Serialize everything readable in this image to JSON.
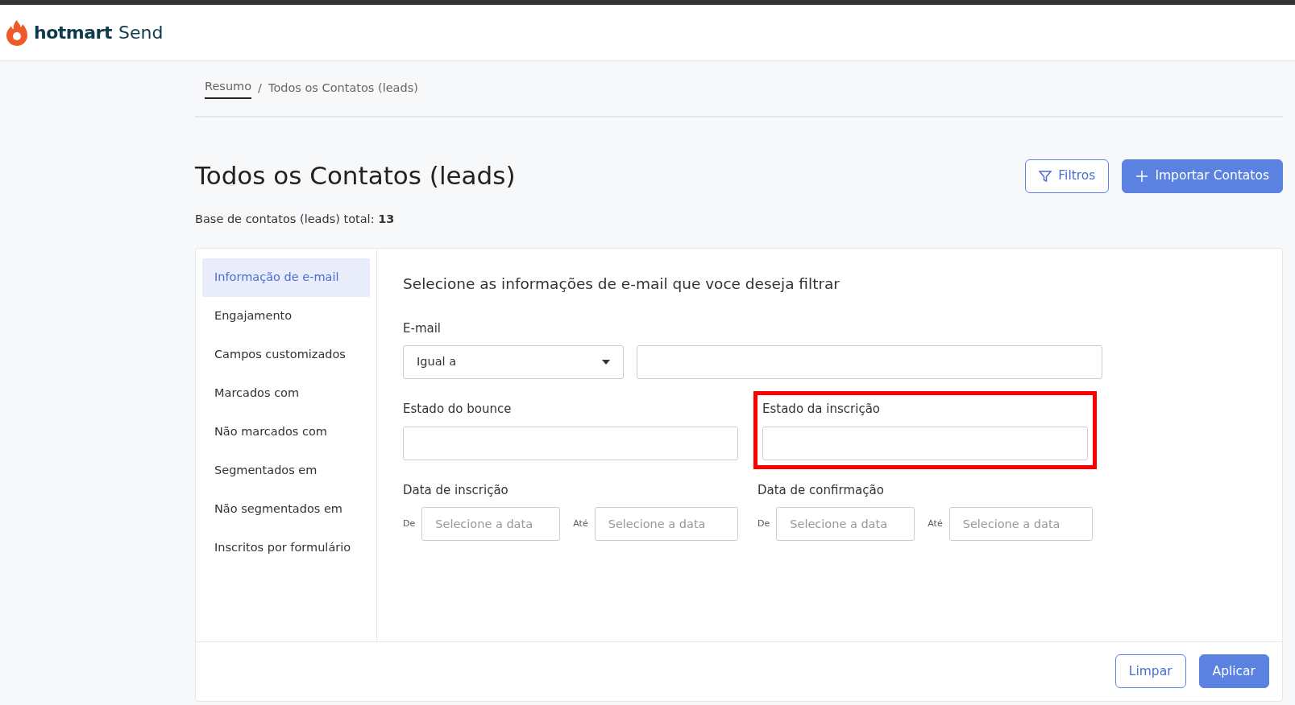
{
  "brand": {
    "name": "hotmart",
    "product": "Send"
  },
  "breadcrumb": [
    {
      "label": "Resumo",
      "link": true
    },
    {
      "separator": "/",
      "label": "Todos os Contatos (leads)",
      "link": false
    }
  ],
  "title": "Todos os Contatos (leads)",
  "buttons": [
    {
      "label": "Filtros",
      "kind": "outline"
    },
    {
      "label": "Importar Contatos",
      "kind": "primary"
    }
  ],
  "total": {
    "label": "Base de contatos (leads) total:",
    "value": "13"
  },
  "filter_menu": [
    {
      "label": "Informação de e-mail",
      "selected": true
    },
    {
      "label": "Engajamento",
      "selected": false
    },
    {
      "label": "Campos customizados",
      "selected": false
    },
    {
      "label": "Marcados com",
      "selected": false
    },
    {
      "label": "Não marcados com",
      "selected": false
    },
    {
      "label": "Segmentados em",
      "selected": false
    },
    {
      "label": "Não segmentados em",
      "selected": false
    },
    {
      "label": "Inscritos por formulário",
      "selected": false
    }
  ],
  "filter_heading": "Selecione as informações de e-mail que voce deseja filtrar",
  "email": {
    "label": "E-mail",
    "operator": "Igual a"
  },
  "bounce": {
    "label": "Estado do bounce",
    "highlighted": false
  },
  "subscription": {
    "label": "Estado da inscrição",
    "highlighted": true
  },
  "date_ranges": [
    {
      "label": "Data de inscrição",
      "from": "De",
      "from_placeholder": "Selecione a data",
      "to": "Até",
      "to_placeholder": "Selecione a data"
    },
    {
      "label": "Data de confirmação",
      "from": "De",
      "from_placeholder": "Selecione a data",
      "to": "Até",
      "to_placeholder": "Selecione a data"
    }
  ],
  "footer_buttons": [
    {
      "label": "Limpar",
      "kind": "outline"
    },
    {
      "label": "Aplicar",
      "kind": "primary"
    }
  ]
}
